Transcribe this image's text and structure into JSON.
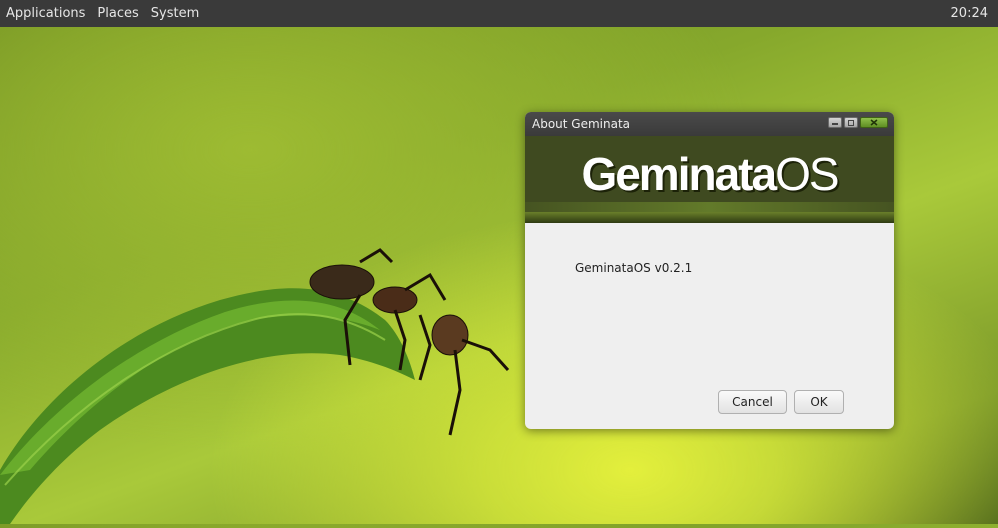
{
  "panel": {
    "menus": [
      "Applications",
      "Places",
      "System"
    ],
    "clock": "20:24"
  },
  "dialog": {
    "title": "About Geminata",
    "logo_main": "Geminata",
    "logo_suffix": "OS",
    "version_text": "GeminataOS v0.2.1",
    "buttons": {
      "cancel": "Cancel",
      "ok": "OK"
    },
    "window_controls": [
      "minimize-icon",
      "maximize-icon",
      "close-icon"
    ]
  },
  "colors": {
    "panel_bg": "#3a3a3a",
    "banner_bg": "#3f4a20",
    "close_button": "#6fa02e"
  }
}
